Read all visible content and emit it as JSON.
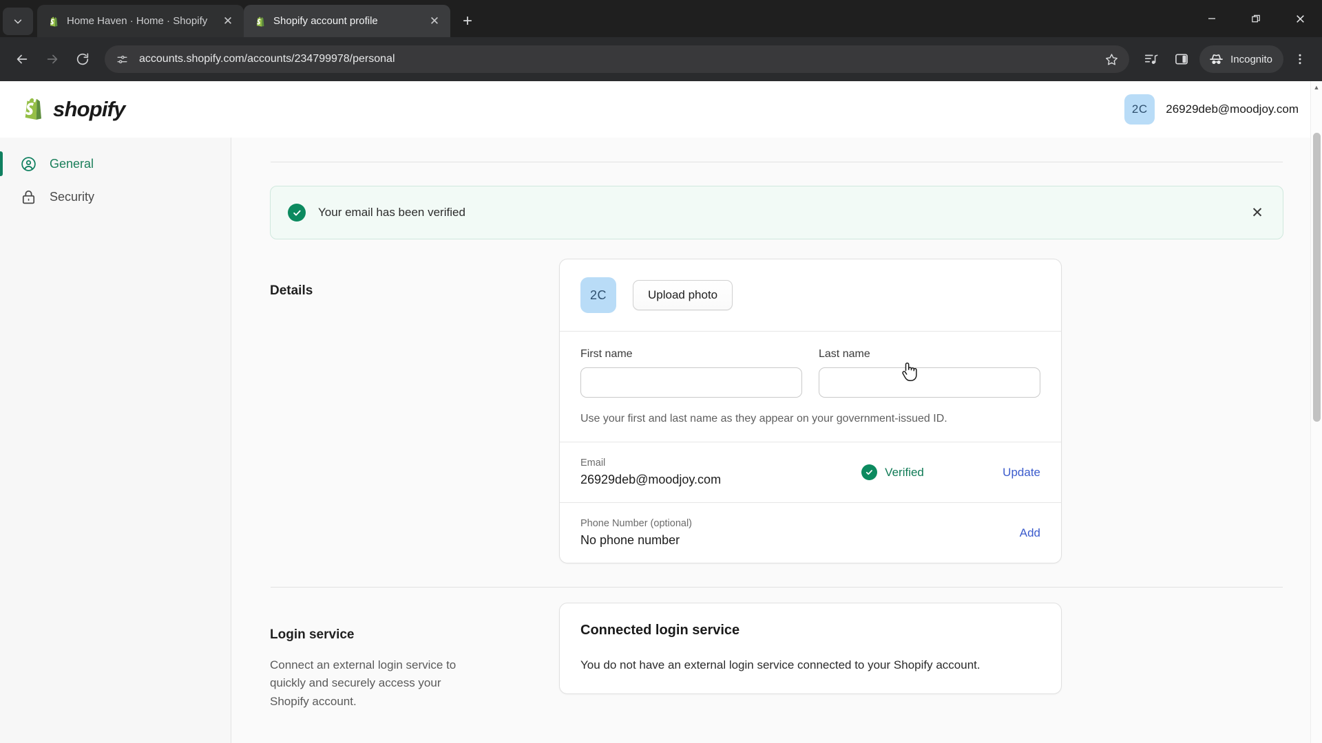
{
  "browser": {
    "tab_search_icon": "chevron-down-icon",
    "tabs": [
      {
        "title": "Home Haven · Home · Shopify",
        "favicon": "shopify-bag-icon",
        "active": false
      },
      {
        "title": "Shopify account profile",
        "favicon": "shopify-bag-icon",
        "active": true
      }
    ],
    "new_tab_label": "+",
    "window_controls": {
      "minimize": "–",
      "maximize": "maximize-icon",
      "close": "×"
    },
    "nav": {
      "back": "back-arrow-icon",
      "forward": "forward-arrow-icon",
      "reload": "reload-icon"
    },
    "omnibox": {
      "site_info_icon": "site-settings-icon",
      "url": "accounts.shopify.com/accounts/234799978/personal",
      "bookmark_icon": "star-icon"
    },
    "toolbar_icons": [
      "reading-list-icon",
      "side-panel-icon"
    ],
    "incognito": {
      "label": "Incognito",
      "icon": "incognito-icon"
    },
    "menu_icon": "three-dots-menu-icon"
  },
  "app": {
    "logo_text": "shopify",
    "account": {
      "avatar_initials": "2C",
      "email": "26929deb@moodjoy.com"
    }
  },
  "sidebar": {
    "items": [
      {
        "label": "General",
        "icon": "user-circle-icon",
        "active": true
      },
      {
        "label": "Security",
        "icon": "lock-icon",
        "active": false
      }
    ]
  },
  "banner": {
    "icon": "check-circle-icon",
    "message": "Your email has been verified",
    "close_icon": "close-icon"
  },
  "details": {
    "section_title": "Details",
    "avatar_initials": "2C",
    "upload_button": "Upload photo",
    "first_name": {
      "label": "First name",
      "value": "",
      "placeholder": ""
    },
    "last_name": {
      "label": "Last name",
      "value": "",
      "placeholder": ""
    },
    "help_text": "Use your first and last name as they appear on your government-issued ID.",
    "email_row": {
      "label": "Email",
      "value": "26929deb@moodjoy.com",
      "status": "Verified",
      "status_icon": "check-circle-icon",
      "action": "Update"
    },
    "phone_row": {
      "label": "Phone Number (optional)",
      "value": "No phone number",
      "action": "Add"
    }
  },
  "login_service": {
    "section_title": "Login service",
    "section_desc": "Connect an external login service to quickly and securely access your Shopify account.",
    "card_title": "Connected login service",
    "card_body": "You do not have an external login service connected to your Shopify account."
  },
  "colors": {
    "shopify_green": "#95bf47",
    "accent_green": "#0c8a5f",
    "link_blue": "#3b5bcc",
    "avatar_blue": "#b9dcf7",
    "banner_bg": "#f2faf6"
  }
}
